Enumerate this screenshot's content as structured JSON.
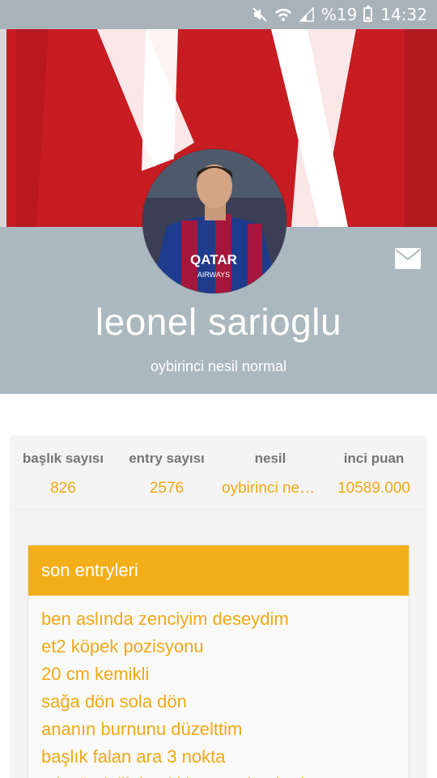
{
  "status_bar": {
    "battery_text": "%19",
    "time": "14:32",
    "icons": [
      "mute-icon",
      "wifi-icon",
      "signal-icon",
      "battery-icon"
    ]
  },
  "profile": {
    "username": "leonel sarioglu",
    "generation_text": "oybirinci nesil normal"
  },
  "stats": [
    {
      "label": "başlık sayısı",
      "value": "826"
    },
    {
      "label": "entry sayısı",
      "value": "2576"
    },
    {
      "label": "nesil",
      "value": "oybirinci nesi..."
    },
    {
      "label": "inci puan",
      "value": "10589.000"
    }
  ],
  "entries_section": {
    "title": "son entryleri",
    "items": [
      "ben aslında zenciyim deseydim",
      "et2 köpek pozisyonu",
      "20 cm kemikli",
      "sağa dön sola dön",
      "ananın burnunu düzelttim",
      "başlık falan ara 3 nokta",
      "tek cümlelik başlıklar trende girmis"
    ]
  },
  "colors": {
    "accent": "#f2af19",
    "header_bg": "#abb8c0",
    "cover_red": "#c91d22"
  }
}
